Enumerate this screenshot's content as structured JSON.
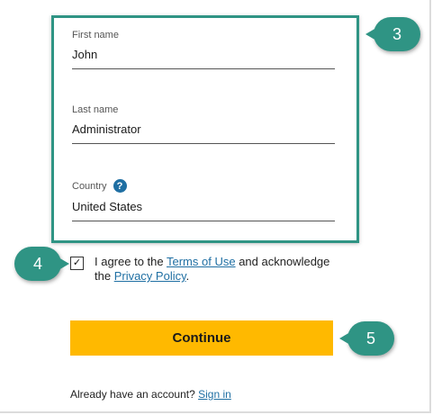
{
  "form": {
    "first_name": {
      "label": "First name",
      "value": "John"
    },
    "last_name": {
      "label": "Last name",
      "value": "Administrator"
    },
    "country": {
      "label": "Country",
      "value": "United States",
      "help_icon": "?"
    }
  },
  "agreement": {
    "checked": true,
    "checkmark": "✓",
    "text_before": "I agree to the ",
    "terms_link": "Terms of Use",
    "text_middle": " and acknowledge the ",
    "privacy_link": "Privacy Policy",
    "text_after": "."
  },
  "continue_label": "Continue",
  "signin": {
    "prompt": "Already have an account? ",
    "link": "Sign in"
  },
  "callouts": {
    "step_3": "3",
    "step_4": "4",
    "step_5": "5"
  },
  "colors": {
    "callout": "#2f9484",
    "button": "#ffb900",
    "link": "#1f6fa3"
  }
}
